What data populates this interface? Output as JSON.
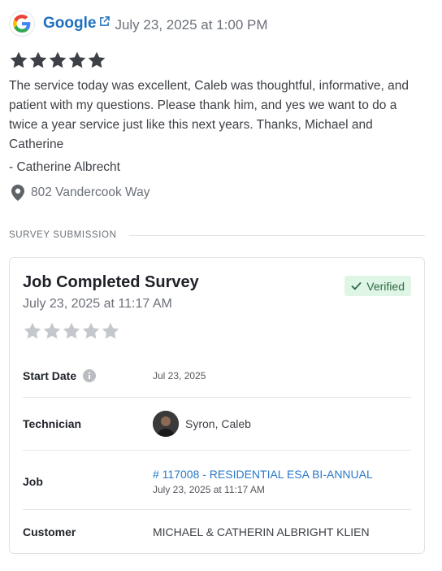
{
  "review": {
    "source": "Google",
    "date": "July 23, 2025 at 1:00 PM",
    "rating": 5,
    "text": "The service today was excellent, Caleb was thoughtful, informative, and patient with my questions. Please thank him, and yes we want to do a twice a year service just like this next years. Thanks, Michael and Catherine",
    "reviewer": "- Catherine Albrecht",
    "address": "802 Vandercook Way"
  },
  "section_label": "SURVEY SUBMISSION",
  "survey": {
    "title": "Job Completed Survey",
    "date": "July 23, 2025 at 11:17 AM",
    "verified_label": "Verified",
    "rating": 0,
    "rows": {
      "start_date": {
        "label": "Start Date",
        "value": "Jul 23, 2025"
      },
      "technician": {
        "label": "Technician",
        "value": "Syron, Caleb"
      },
      "job": {
        "label": "Job",
        "link": "# 117008 - RESIDENTIAL ESA BI-ANNUAL",
        "sub": "July 23, 2025 at 11:17 AM"
      },
      "customer": {
        "label": "Customer",
        "value": "MICHAEL & CATHERIN ALBRIGHT KLIEN"
      }
    }
  },
  "colors": {
    "link": "#1f6fbf",
    "star_filled": "#3d4046",
    "star_empty": "#c4c7cc",
    "verified_bg": "#dff5e6",
    "verified_text": "#2e6b44"
  },
  "icons": {
    "logo": "google-g-icon",
    "external": "external-link-icon",
    "location": "map-pin-icon",
    "check": "check-icon",
    "info": "info-icon",
    "star": "star-icon"
  }
}
